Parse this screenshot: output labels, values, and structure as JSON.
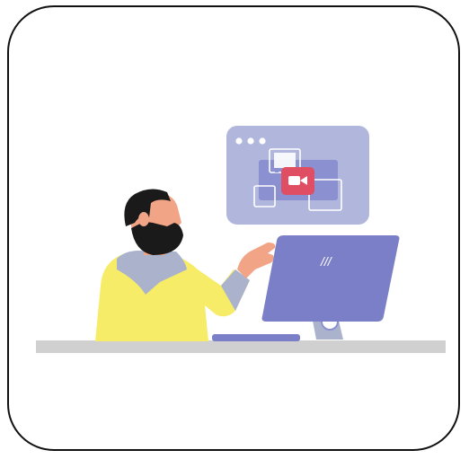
{
  "illustration": {
    "subject": "man-using-desktop-computer-video-call",
    "monitor_text": "///",
    "colors": {
      "frame_border": "#111111",
      "background": "#ffffff",
      "desk": "#d0d0d0",
      "monitor": "#7b7fc7",
      "browser_window": "#b0b6dc",
      "video_badge": "#e04e63",
      "shirt": "#f7ec68",
      "collar": "#aab2cc",
      "skin": "#f2a487",
      "hair": "#1a1a1a"
    },
    "icons": [
      "window-dots-icon",
      "video-camera-icon",
      "image-placeholder-icon"
    ]
  }
}
